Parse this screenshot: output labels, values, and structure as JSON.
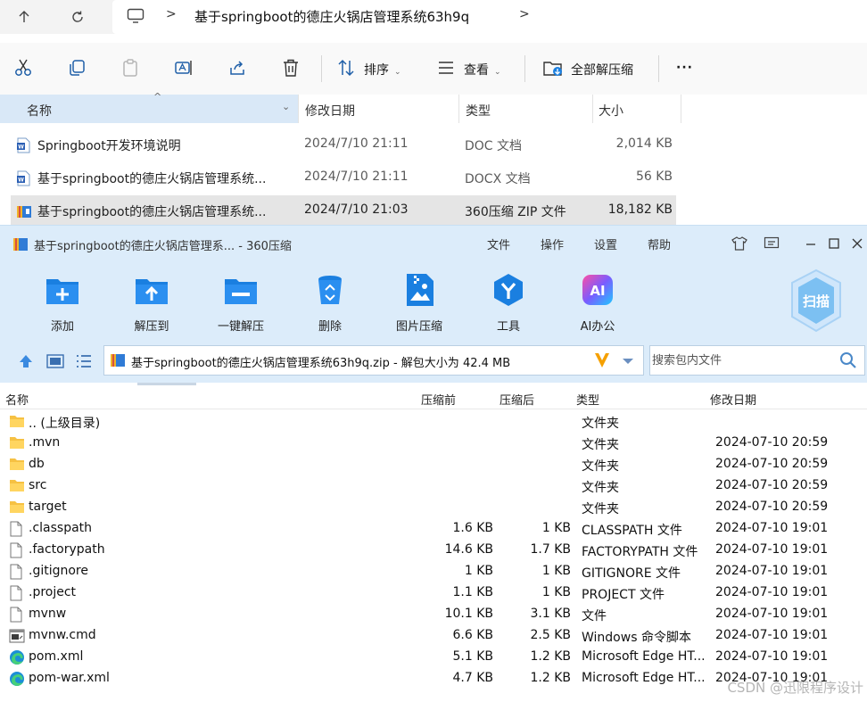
{
  "explorer": {
    "address": {
      "path": "基于springboot的德庄火锅店管理系统63h9q",
      "separator": ">"
    },
    "toolbar": {
      "sort_label": "排序",
      "view_label": "查看",
      "extract_all_label": "全部解压缩",
      "more_label": "···"
    },
    "columns": {
      "name": "名称",
      "modified": "修改日期",
      "type": "类型",
      "size": "大小"
    },
    "files": [
      {
        "name": "Springboot开发环境说明",
        "modified": "2024/7/10 21:11",
        "type": "DOC 文档",
        "size": "2,014 KB",
        "icon": "word-icon"
      },
      {
        "name": "基于springboot的德庄火锅店管理系统...",
        "modified": "2024/7/10 21:11",
        "type": "DOCX 文档",
        "size": "56 KB",
        "icon": "word-icon"
      },
      {
        "name": "基于springboot的德庄火锅店管理系统...",
        "modified": "2024/7/10 21:03",
        "type": "360压缩 ZIP 文件",
        "size": "18,182 KB",
        "icon": "zip-archive-icon"
      }
    ]
  },
  "zip": {
    "title": "基于springboot的德庄火锅店管理系... - 360压缩",
    "menu": [
      "文件",
      "操作",
      "设置",
      "帮助"
    ],
    "tools": [
      {
        "label": "添加",
        "icon": "add-folder-icon"
      },
      {
        "label": "解压到",
        "icon": "extract-to-folder-icon"
      },
      {
        "label": "一键解压",
        "icon": "one-click-extract-icon"
      },
      {
        "label": "删除",
        "icon": "recycle-bin-icon"
      },
      {
        "label": "图片压缩",
        "icon": "image-compress-icon"
      },
      {
        "label": "工具",
        "icon": "tools-icon"
      },
      {
        "label": "AI办公",
        "icon": "ai-office-icon"
      }
    ],
    "scan_label": "扫描",
    "path_text": "基于springboot的德庄火锅店管理系统63h9q.zip - 解包大小为 42.4 MB",
    "search_placeholder": "搜索包内文件",
    "columns": {
      "name": "名称",
      "before": "压缩前",
      "after": "压缩后",
      "type": "类型",
      "modified": "修改日期"
    },
    "rows": [
      {
        "name": ".. (上级目录)",
        "before": "",
        "after": "",
        "type": "文件夹",
        "modified": "",
        "icon": "folder-icon"
      },
      {
        "name": ".mvn",
        "before": "",
        "after": "",
        "type": "文件夹",
        "modified": "2024-07-10 20:59",
        "icon": "folder-icon"
      },
      {
        "name": "db",
        "before": "",
        "after": "",
        "type": "文件夹",
        "modified": "2024-07-10 20:59",
        "icon": "folder-icon"
      },
      {
        "name": "src",
        "before": "",
        "after": "",
        "type": "文件夹",
        "modified": "2024-07-10 20:59",
        "icon": "folder-icon"
      },
      {
        "name": "target",
        "before": "",
        "after": "",
        "type": "文件夹",
        "modified": "2024-07-10 20:59",
        "icon": "folder-icon"
      },
      {
        "name": ".classpath",
        "before": "1.6 KB",
        "after": "1 KB",
        "type": "CLASSPATH 文件",
        "modified": "2024-07-10 19:01",
        "icon": "file-icon"
      },
      {
        "name": ".factorypath",
        "before": "14.6 KB",
        "after": "1.7 KB",
        "type": "FACTORYPATH 文件",
        "modified": "2024-07-10 19:01",
        "icon": "file-icon"
      },
      {
        "name": ".gitignore",
        "before": "1 KB",
        "after": "1 KB",
        "type": "GITIGNORE 文件",
        "modified": "2024-07-10 19:01",
        "icon": "file-icon"
      },
      {
        "name": ".project",
        "before": "1.1 KB",
        "after": "1 KB",
        "type": "PROJECT 文件",
        "modified": "2024-07-10 19:01",
        "icon": "file-icon"
      },
      {
        "name": "mvnw",
        "before": "10.1 KB",
        "after": "3.1 KB",
        "type": "文件",
        "modified": "2024-07-10 19:01",
        "icon": "file-icon"
      },
      {
        "name": "mvnw.cmd",
        "before": "6.6 KB",
        "after": "2.5 KB",
        "type": "Windows 命令脚本",
        "modified": "2024-07-10 19:01",
        "icon": "cmd-script-icon"
      },
      {
        "name": "pom.xml",
        "before": "5.1 KB",
        "after": "1.2 KB",
        "type": "Microsoft Edge HT...",
        "modified": "2024-07-10 19:01",
        "icon": "edge-icon"
      },
      {
        "name": "pom-war.xml",
        "before": "4.7 KB",
        "after": "1.2 KB",
        "type": "Microsoft Edge HT...",
        "modified": "2024-07-10 19:01",
        "icon": "edge-icon"
      }
    ]
  },
  "watermark": "CSDN @迅限程序设计",
  "colors": {
    "zip_chrome": "#dcecfa",
    "selected_header": "#d9e8f7",
    "folder": "#f6c143",
    "accent_blue": "#1a7fe0"
  }
}
